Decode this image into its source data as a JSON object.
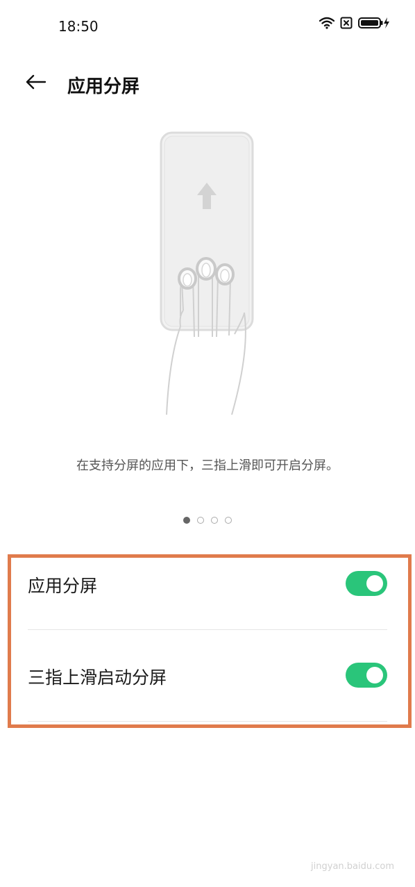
{
  "status_bar": {
    "time": "18:50"
  },
  "header": {
    "title": "应用分屏"
  },
  "illustration": {
    "caption": "在支持分屏的应用下，三指上滑即可开启分屏。"
  },
  "pager": {
    "count": 4,
    "active_index": 0
  },
  "settings": [
    {
      "label": "应用分屏",
      "enabled": true
    },
    {
      "label": "三指上滑启动分屏",
      "enabled": true
    }
  ],
  "colors": {
    "toggle_on": "#2ac57a",
    "highlight": "#e07b4c"
  },
  "watermark": {
    "text": "jingyan.baidu.com"
  }
}
